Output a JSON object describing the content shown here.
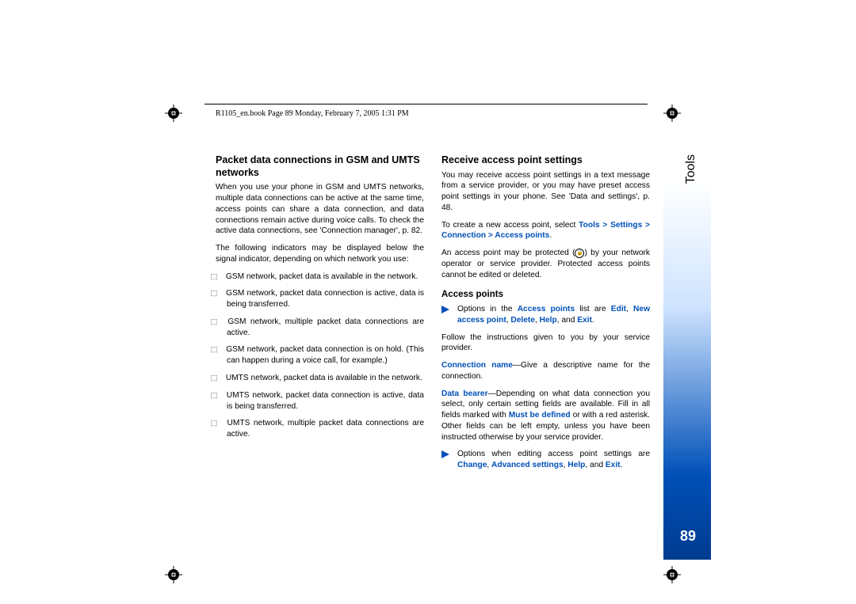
{
  "header": {
    "text": "R1105_en.book  Page 89  Monday, February 7, 2005  1:31 PM"
  },
  "side": {
    "section": "Tools",
    "page_number": "89"
  },
  "left_col": {
    "h1": "Packet data connections in GSM and UMTS networks",
    "p1": "When you use your phone in GSM and UMTS networks, multiple data connections can be active at the same time, access points can share a data connection, and data connections remain active during voice calls. To check the active data connections, see 'Connection manager', p. 82.",
    "p2": "The following indicators may be displayed below the signal indicator, depending on which network you use:",
    "b1_icon": "⬚",
    "b1": "GSM network, packet data is available in the network.",
    "b2_icon": "⬚",
    "b2": "GSM network, packet data connection is active, data is being transferred.",
    "b3_icon": "⬚",
    "b3": "GSM network, multiple packet data connections are active.",
    "b4_icon": "⬚",
    "b4": "GSM network, packet data connection is on hold. (This can happen during a voice call, for example.)",
    "b5_icon": "⬚",
    "b5": "UMTS network, packet data is available in the network.",
    "b6_icon": "⬚",
    "b6": "UMTS network, packet data connection is active, data is being transferred.",
    "b7_icon": "⬚",
    "b7": "UMTS network, multiple packet data connections are active."
  },
  "right_col": {
    "h1": "Receive access point settings",
    "p1": "You may receive access point settings in a text message from a service provider, or you may have preset access point settings in your phone. See 'Data and settings', p. 48.",
    "p2a": "To create a new access point, select ",
    "p2b_blue": "Tools > Settings > Connection > Access points",
    "p2c": ".",
    "p3a": "An access point may be protected (",
    "p3_lock": "🔒",
    "p3b": ") by your network operator or service provider. Protected access points cannot be edited or deleted.",
    "h2": "Access points",
    "tip1a": "Options in the ",
    "tip1b_blue": "Access points",
    "tip1c": " list are ",
    "tip1d_blue": "Edit",
    "tip1e": ", ",
    "tip1f_blue": "New access point",
    "tip1g": ", ",
    "tip1h_blue": "Delete",
    "tip1i": ", ",
    "tip1j_blue": "Help",
    "tip1k": ", and ",
    "tip1l_blue": "Exit",
    "tip1m": ".",
    "p4": "Follow the instructions given to you by your service provider.",
    "p5a_blue": "Connection name",
    "p5b": "—Give a descriptive name for the connection.",
    "p6a_blue": "Data bearer",
    "p6b": "—Depending on what data connection you select, only certain setting fields are available. Fill in all fields marked with ",
    "p6c_blue": "Must be defined",
    "p6d": " or with a red asterisk. Other fields can be left empty, unless you have been instructed otherwise by your service provider.",
    "tip2a": "Options when editing access point settings are ",
    "tip2b_blue": "Change",
    "tip2c": ", ",
    "tip2d_blue": "Advanced settings",
    "tip2e": ", ",
    "tip2f_blue": "Help",
    "tip2g": ", and ",
    "tip2h_blue": "Exit",
    "tip2i": "."
  }
}
